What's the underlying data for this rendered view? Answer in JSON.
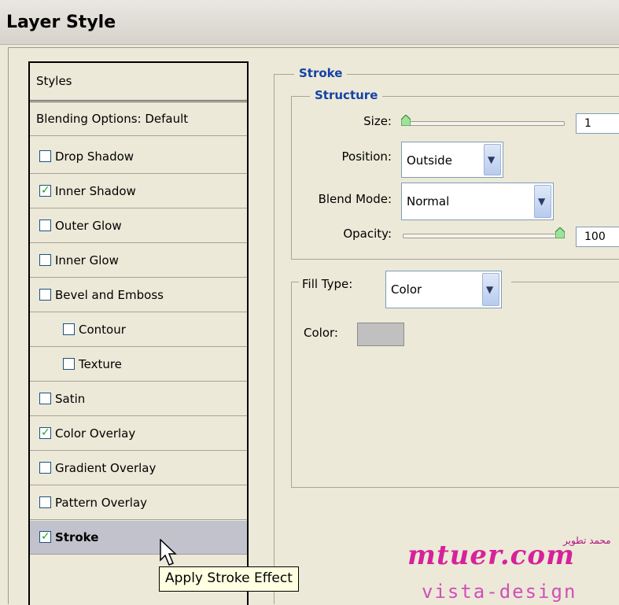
{
  "window": {
    "title": "Layer Style"
  },
  "style_list": {
    "header": "Styles",
    "blending": "Blending Options: Default",
    "items": [
      {
        "label": "Drop Shadow",
        "checked": false
      },
      {
        "label": "Inner Shadow",
        "checked": true
      },
      {
        "label": "Outer Glow",
        "checked": false
      },
      {
        "label": "Inner Glow",
        "checked": false
      },
      {
        "label": "Bevel and Emboss",
        "checked": false
      },
      {
        "label": "Contour",
        "checked": false
      },
      {
        "label": "Texture",
        "checked": false
      },
      {
        "label": "Satin",
        "checked": false
      },
      {
        "label": "Color Overlay",
        "checked": true
      },
      {
        "label": "Gradient Overlay",
        "checked": false
      },
      {
        "label": "Pattern Overlay",
        "checked": false
      },
      {
        "label": "Stroke",
        "checked": true
      }
    ]
  },
  "stroke": {
    "title": "Stroke",
    "structure_title": "Structure",
    "size_label": "Size:",
    "size_value": "1",
    "position_label": "Position:",
    "position_value": "Outside",
    "blend_label": "Blend Mode:",
    "blend_value": "Normal",
    "opacity_label": "Opacity:",
    "opacity_value": "100",
    "fill_type_label": "Fill Type:",
    "fill_type_value": "Color",
    "color_label": "Color:"
  },
  "colors": {
    "swatch": "#c0c0c0",
    "title_blue": "#1542a8"
  },
  "tooltip": "Apply Stroke Effect",
  "watermark": {
    "main": "mtuer.com",
    "sub": "vista-design",
    "arabic": "محمد تطوير"
  }
}
